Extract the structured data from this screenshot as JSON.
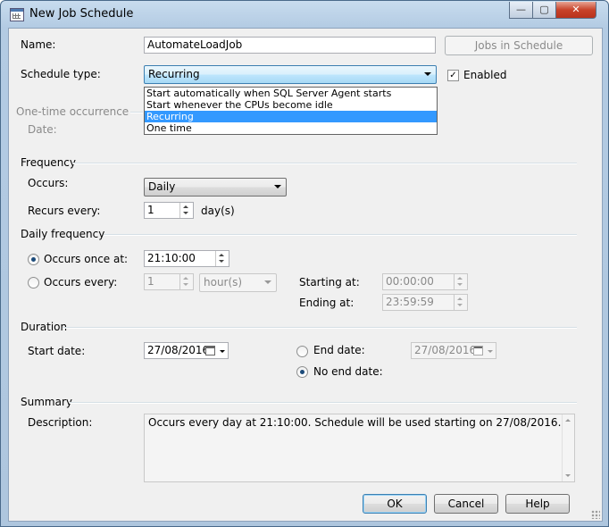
{
  "window": {
    "title": "New Job Schedule",
    "minimize": "—",
    "maximize": "▢",
    "close": "✕"
  },
  "form": {
    "name_label": "Name:",
    "name_value": "AutomateLoadJob",
    "jobs_in_schedule": "Jobs in Schedule",
    "schedule_type_label": "Schedule type:",
    "schedule_type_value": "Recurring",
    "enabled_label": "Enabled",
    "enabled_checked": true,
    "schedule_type_options": [
      "Start automatically when SQL Server Agent starts",
      "Start whenever the CPUs become idle",
      "Recurring",
      "One time"
    ],
    "schedule_type_selected_index": 2
  },
  "one_time": {
    "group_label": "One-time occurrence",
    "date_label": "Date:"
  },
  "frequency": {
    "group_label": "Frequency",
    "occurs_label": "Occurs:",
    "occurs_value": "Daily",
    "recurs_label": "Recurs every:",
    "recurs_value": "1",
    "recurs_unit": "day(s)"
  },
  "daily_frequency": {
    "group_label": "Daily frequency",
    "once_label": "Occurs once at:",
    "once_value": "21:10:00",
    "once_selected": true,
    "every_label": "Occurs every:",
    "every_value": "1",
    "every_unit": "hour(s)",
    "starting_label": "Starting at:",
    "starting_value": "00:00:00",
    "ending_label": "Ending at:",
    "ending_value": "23:59:59"
  },
  "duration": {
    "group_label": "Duration",
    "start_label": "Start date:",
    "start_value": "27/08/2016",
    "end_label": "End date:",
    "end_value": "27/08/2016",
    "no_end_label": "No end date:",
    "no_end_selected": true
  },
  "summary": {
    "group_label": "Summary",
    "description_label": "Description:",
    "description": "Occurs every day at 21:10:00. Schedule will be used starting on 27/08/2016."
  },
  "buttons": {
    "ok": "OK",
    "cancel": "Cancel",
    "help": "Help"
  },
  "colors": {
    "selection": "#3399ff",
    "title_bar": "#b3cbe3",
    "close_button": "#c8432a"
  }
}
